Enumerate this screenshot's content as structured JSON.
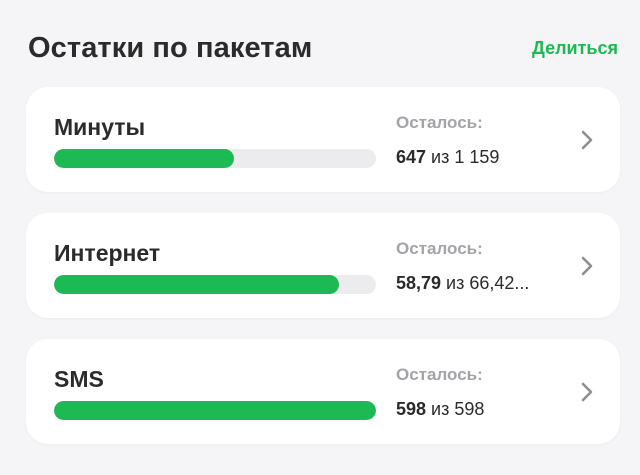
{
  "header": {
    "title": "Остатки по пакетам",
    "share_label": "Делиться"
  },
  "colors": {
    "accent": "#1db954",
    "track": "#ececee",
    "muted": "#a3a3a8"
  },
  "packages": [
    {
      "name": "Минуты",
      "remain_label": "Осталось:",
      "remaining": "647",
      "of_word": "из",
      "total": "1 159",
      "fill_fraction": 0.56,
      "icon": "chevron-right-icon"
    },
    {
      "name": "Интернет",
      "remain_label": "Осталось:",
      "remaining": "58,79",
      "of_word": "из",
      "total": "66,42...",
      "fill_fraction": 0.885,
      "icon": "chevron-right-icon"
    },
    {
      "name": "SMS",
      "remain_label": "Осталось:",
      "remaining": "598",
      "of_word": "из",
      "total": "598",
      "fill_fraction": 1.0,
      "icon": "chevron-right-icon"
    }
  ]
}
